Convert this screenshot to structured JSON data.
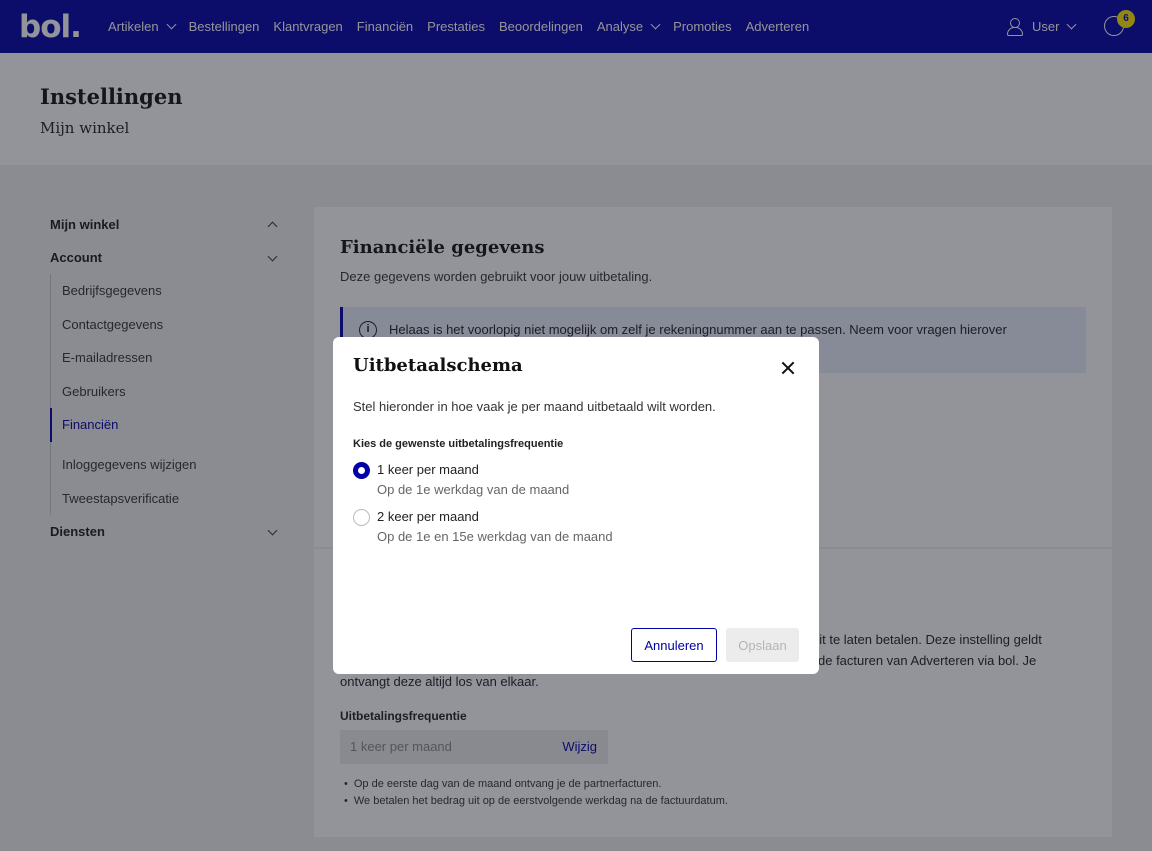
{
  "nav": {
    "logo": "bol.",
    "items": [
      {
        "label": "Artikelen",
        "dropdown": true
      },
      {
        "label": "Bestellingen",
        "dropdown": false
      },
      {
        "label": "Klantvragen",
        "dropdown": false
      },
      {
        "label": "Financiën",
        "dropdown": false
      },
      {
        "label": "Prestaties",
        "dropdown": false
      },
      {
        "label": "Beoordelingen",
        "dropdown": false
      },
      {
        "label": "Analyse",
        "dropdown": true
      },
      {
        "label": "Promoties",
        "dropdown": false
      },
      {
        "label": "Adverteren",
        "dropdown": false
      }
    ],
    "user_label": "User",
    "coin_badge": "6",
    "colors": {
      "nav_bg": "#0000a4",
      "badge": "#ffe800"
    }
  },
  "page": {
    "title": "Instellingen",
    "subtitle": "Mijn winkel"
  },
  "sidebar": {
    "groups": [
      {
        "label": "Mijn winkel",
        "expanded": false
      },
      {
        "label": "Account",
        "expanded": true
      },
      {
        "label": "Diensten",
        "expanded": false
      }
    ],
    "account_items": [
      {
        "label": "Bedrijfsgegevens",
        "active": false
      },
      {
        "label": "Contactgegevens",
        "active": false
      },
      {
        "label": "E-mailadressen",
        "active": false
      },
      {
        "label": "Gebruikers",
        "active": false
      },
      {
        "label": "Financiën",
        "active": true
      },
      {
        "label": "Inloggegevens wijzigen",
        "active": false
      },
      {
        "label": "Tweestapsverificatie",
        "active": false
      }
    ]
  },
  "card": {
    "title": "Financiële gegevens",
    "description": "Deze gegevens worden gebruikt voor jouw uitbetaling.",
    "info": "Helaas is het voorlopig niet mogelijk om zelf je rekeningnummer aan te passen. Neem voor vragen hierover"
  },
  "card2": {
    "text_line1": "uit te laten betalen. Deze instelling geldt",
    "text_line2": "de facturen van Adverteren via bol. Je",
    "text_line3": "ontvangt deze altijd los van elkaar.",
    "field_label": "Uitbetalingsfrequentie",
    "field_value": "1 keer per maand",
    "field_link": "Wijzig",
    "bullets": [
      "Op de eerste dag van de maand ontvang je de partnerfacturen.",
      "We betalen het bedrag uit op de eerstvolgende werkdag na de factuurdatum."
    ]
  },
  "modal": {
    "title": "Uitbetaalschema",
    "description": "Stel hieronder in hoe vaak je per maand uitbetaald wilt worden.",
    "label": "Kies de gewenste uitbetalingsfrequentie",
    "options": [
      {
        "label": "1 keer per maand",
        "sub": "Op de 1e werkdag van de maand",
        "selected": true
      },
      {
        "label": "2 keer per maand",
        "sub": "Op de 1e en 15e werkdag van de maand",
        "selected": false
      }
    ],
    "cancel_label": "Annuleren",
    "save_label": "Opslaan",
    "save_disabled": true
  }
}
